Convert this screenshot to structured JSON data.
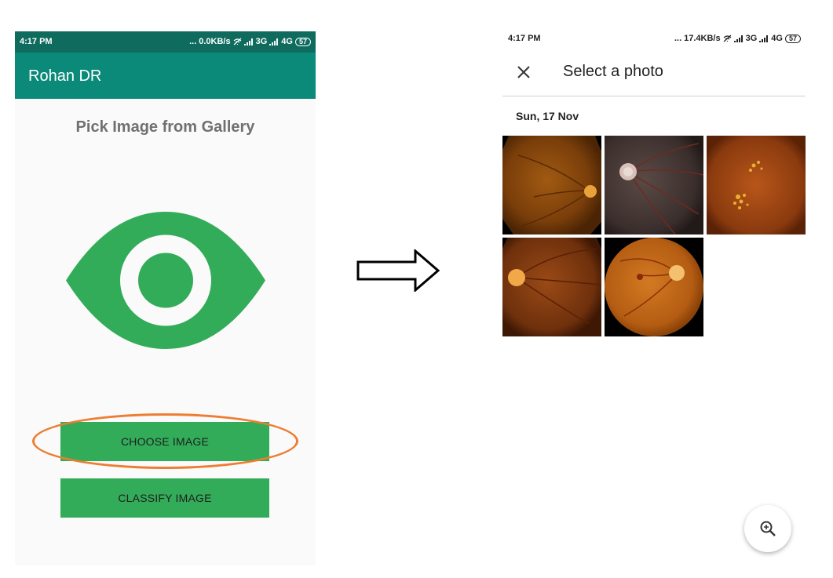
{
  "left_screen": {
    "status_bar": {
      "time": "4:17 PM",
      "dots": "...",
      "speed": "0.0KB/s",
      "net1": "3G",
      "net2": "4G",
      "battery": "57"
    },
    "app_title": "Rohan DR",
    "pick_label": "Pick Image from Gallery",
    "buttons": {
      "choose": "CHOOSE IMAGE",
      "classify": "CLASSIFY IMAGE"
    }
  },
  "right_screen": {
    "status_bar": {
      "time": "4:17 PM",
      "dots": "...",
      "speed": "17.4KB/s",
      "net1": "3G",
      "net2": "4G",
      "battery": "57"
    },
    "title": "Select a photo",
    "date_label": "Sun, 17 Nov",
    "photos": [
      {
        "name": "fundus-photo-1"
      },
      {
        "name": "fundus-photo-2"
      },
      {
        "name": "fundus-photo-3"
      },
      {
        "name": "fundus-photo-4"
      },
      {
        "name": "fundus-photo-5"
      }
    ]
  },
  "colors": {
    "status_bar": "#0e6b5e",
    "app_bar": "#0b8a79",
    "button": "#33ac59",
    "eye": "#33ac59",
    "highlight_oval": "#ed7d31"
  },
  "icons": [
    "eye-icon",
    "right-arrow-icon",
    "close-icon",
    "zoom-in-icon",
    "wifi-off-icon",
    "signal-icon"
  ]
}
